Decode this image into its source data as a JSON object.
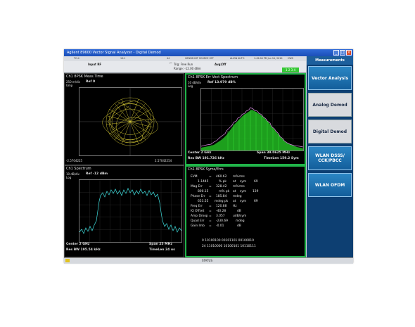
{
  "window": {
    "title": "Agilent 89600 Vector Signal Analyzer - Digital Demod",
    "minimize_glyph": "_",
    "maximize_glyph": "□",
    "close_glyph": "×"
  },
  "toolbar": {
    "items": [
      "TO:4",
      "19:1",
      "44",
      "GENS8 INIT SOURCE OFF",
      "ALIGN AUTO",
      "1:49:00 PM Jun 10, 2010",
      "HWS"
    ]
  },
  "status": {
    "input_label": "Input RF",
    "avg_label": "Avg|Off",
    "trig_label": "Trig: Free Run",
    "range_label": "Range: -12.00 dBm",
    "meas_button": "1 2 3 4"
  },
  "panes": {
    "meas_time": {
      "title": "Ch1 8PSK Meas Time",
      "scale": "250 m/div",
      "unit": "Ump",
      "ref": "Ref 0",
      "x_left": "-2.5704225",
      "x_right": "2.57042254"
    },
    "err_vect": {
      "title": "Ch1 8PSK Err Vect Spectrum",
      "scale": "10 dB/div",
      "unit": "Log",
      "ref": "Ref 13.979 dB%",
      "center": "Center 2 GHz",
      "span": "Span 39.0625 MHz",
      "resbw": "Res BW 191.726 kHz",
      "timelen": "TimeLen 159.2 Sym"
    },
    "spectrum": {
      "title": "Ch1 Spectrum",
      "scale": "10 dB/div",
      "unit": "Log",
      "ref": "Ref -12 dBm",
      "center": "Center 2 GHz",
      "span": "Span 25 MHz",
      "resbw": "Res BW 195.54 kHz",
      "timelen": "TimeLen 24 us"
    },
    "syms": {
      "title": "Ch1 8PSK Syms/Errs",
      "rows": [
        [
          "EVM",
          "=",
          "460.62",
          "m%rms",
          "",
          ""
        ],
        [
          "",
          "1.1445",
          "% pk",
          "at",
          "sym",
          "69"
        ],
        [
          "Mag Err",
          "=",
          "328.42",
          "m%rms",
          "",
          ""
        ],
        [
          "",
          "800.15",
          "m% pk",
          "at",
          "sym",
          "139"
        ],
        [
          "Phase Err",
          "=",
          "185.84",
          "mdeg",
          "",
          ""
        ],
        [
          "",
          "653.55",
          "mdeg pk",
          "at",
          "sym",
          "69"
        ],
        [
          "Freq Err",
          "=",
          "120.88",
          "Hz",
          "",
          ""
        ],
        [
          "IQ Offset",
          "=",
          "-40.28",
          "dB",
          "",
          ""
        ],
        [
          "Amp Droop",
          "=",
          "3.057",
          "udB/sym",
          "",
          ""
        ],
        [
          "Quad Err",
          "=",
          "-230.69",
          "mdeg",
          "",
          ""
        ],
        [
          "Gain Imb",
          "=",
          "-0.01",
          "dB",
          "",
          ""
        ]
      ],
      "bits": [
        "0   10100100  00101101  00100010",
        "24  11010000  10100101  10110111"
      ]
    }
  },
  "sidebar": {
    "header": "Measurements",
    "buttons": [
      "Vector Analysis",
      "Analog Demod",
      "Digital Demod",
      "WLAN DSSS/\nCCK/PBCC",
      "WLAN OFDM"
    ]
  },
  "footer": {
    "status": "STATUS"
  }
}
